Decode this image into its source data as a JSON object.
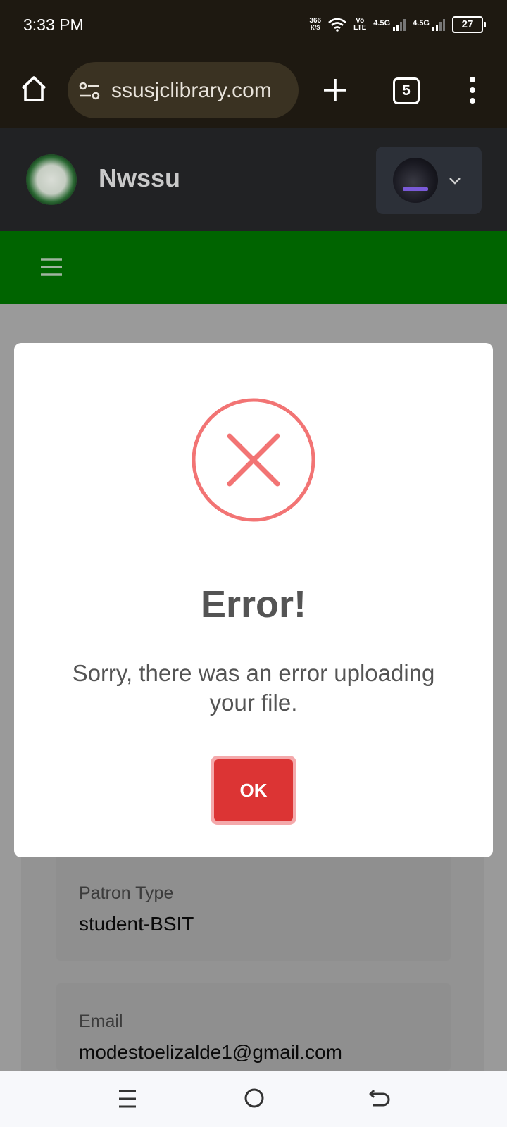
{
  "status_bar": {
    "time": "3:33 PM",
    "net_speed_value": "366",
    "net_speed_unit": "K/S",
    "volte_top": "Vo",
    "volte_bottom": "LTE",
    "signal1_label": "4.5G",
    "signal2_label": "4.5G",
    "battery": "27"
  },
  "browser": {
    "url": "ssusjclibrary.com",
    "tab_count": "5"
  },
  "site": {
    "title": "Nwssu"
  },
  "profile_fields": [
    {
      "label": "Patron Type",
      "value": "student-BSIT"
    },
    {
      "label": "Email",
      "value": "modestoelizalde1@gmail.com"
    }
  ],
  "modal": {
    "title": "Error!",
    "message": "Sorry, there was an error uploading your file.",
    "ok_label": "OK",
    "icon": "error-x-icon",
    "icon_color": "#f27474",
    "button_color": "#dc3434"
  },
  "colors": {
    "header_bg": "#212224",
    "brand_green": "#006400",
    "browser_bg": "#1e1911"
  }
}
